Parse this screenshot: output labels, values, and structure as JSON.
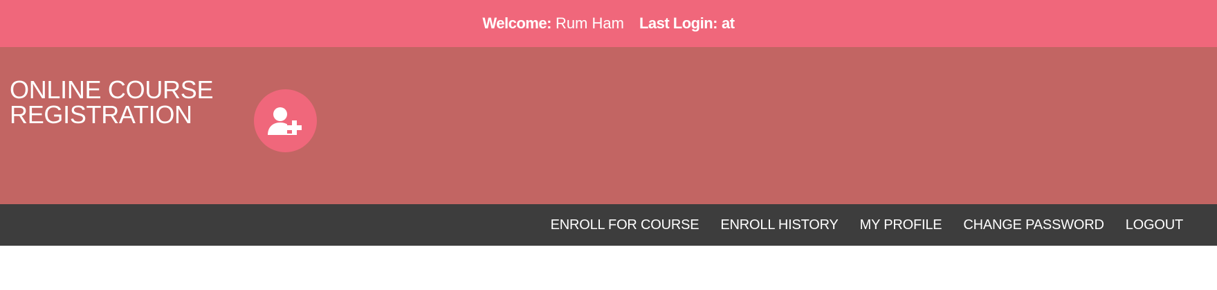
{
  "top_bar": {
    "welcome_label": "Welcome:",
    "welcome_name": "Rum Ham",
    "last_login_label": "Last Login:",
    "last_login_value": "at"
  },
  "header": {
    "title": "ONLINE COURSE REGISTRATION",
    "logo_icon": "user-plus-icon"
  },
  "nav": {
    "items": [
      {
        "label": "ENROLL FOR COURSE"
      },
      {
        "label": "ENROLL HISTORY"
      },
      {
        "label": "MY PROFILE"
      },
      {
        "label": "CHANGE PASSWORD"
      },
      {
        "label": "LOGOUT"
      }
    ]
  },
  "colors": {
    "top_bar": "#f0677b",
    "header": "#c26563",
    "nav": "#3d3d3d",
    "logo_circle": "#f0677b"
  }
}
